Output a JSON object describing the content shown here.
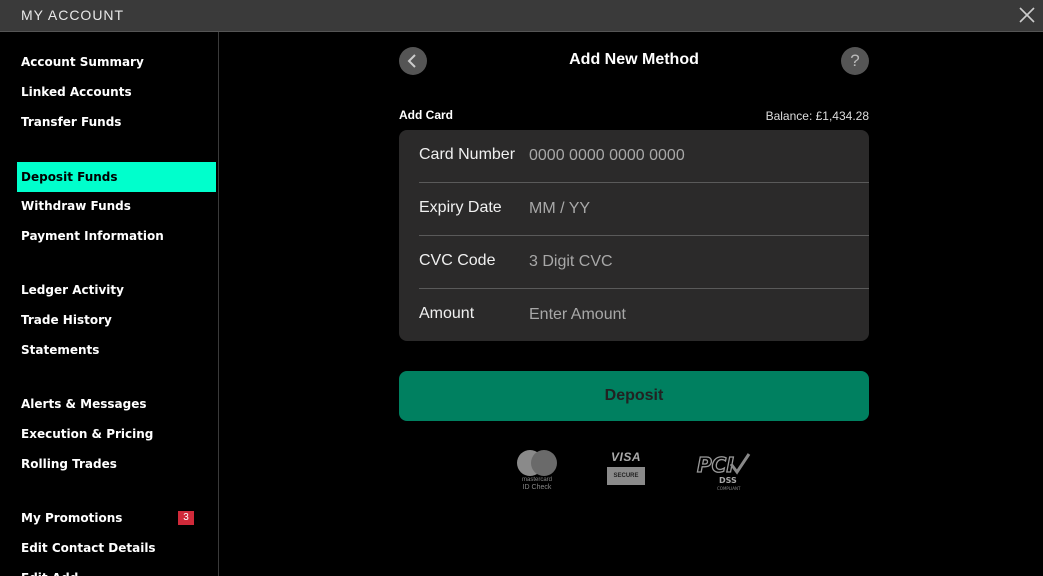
{
  "window": {
    "title": "MY ACCOUNT"
  },
  "sidebar": {
    "items": [
      {
        "label": "Account Summary"
      },
      {
        "label": "Linked Accounts"
      },
      {
        "label": "Transfer Funds"
      },
      {
        "label": "Deposit Funds",
        "active": true
      },
      {
        "label": "Withdraw Funds"
      },
      {
        "label": "Payment Information"
      },
      {
        "label": "Ledger Activity"
      },
      {
        "label": "Trade History"
      },
      {
        "label": "Statements"
      },
      {
        "label": "Alerts & Messages"
      },
      {
        "label": "Execution & Pricing"
      },
      {
        "label": "Rolling Trades"
      },
      {
        "label": "My Promotions",
        "badge": "3"
      },
      {
        "label": "Edit Contact Details"
      },
      {
        "label": "Edit Add"
      }
    ]
  },
  "main": {
    "title": "Add New Method",
    "help_label": "?",
    "section_label": "Add Card",
    "balance": "Balance: £1,434.28",
    "fields": [
      {
        "label": "Card Number",
        "placeholder": "0000 0000 0000 0000",
        "value": ""
      },
      {
        "label": "Expiry Date",
        "placeholder": "MM / YY",
        "value": ""
      },
      {
        "label": "CVC Code",
        "placeholder": "3 Digit CVC",
        "value": ""
      },
      {
        "label": "Amount",
        "placeholder": "Enter Amount",
        "value": ""
      }
    ],
    "deposit_label": "Deposit"
  },
  "logos": {
    "mastercard_line1": "mastercard",
    "mastercard_line2": "ID Check",
    "visa_brand": "VISA",
    "visa_secure": "SECURE",
    "pci_brand": "PCI",
    "pci_dss": "DSS",
    "pci_compliant": "COMPLIANT"
  },
  "colors": {
    "active_nav": "#00ffcc",
    "deposit_button": "#008060",
    "badge": "#d02a3a",
    "card_background": "#2b2a2a"
  }
}
